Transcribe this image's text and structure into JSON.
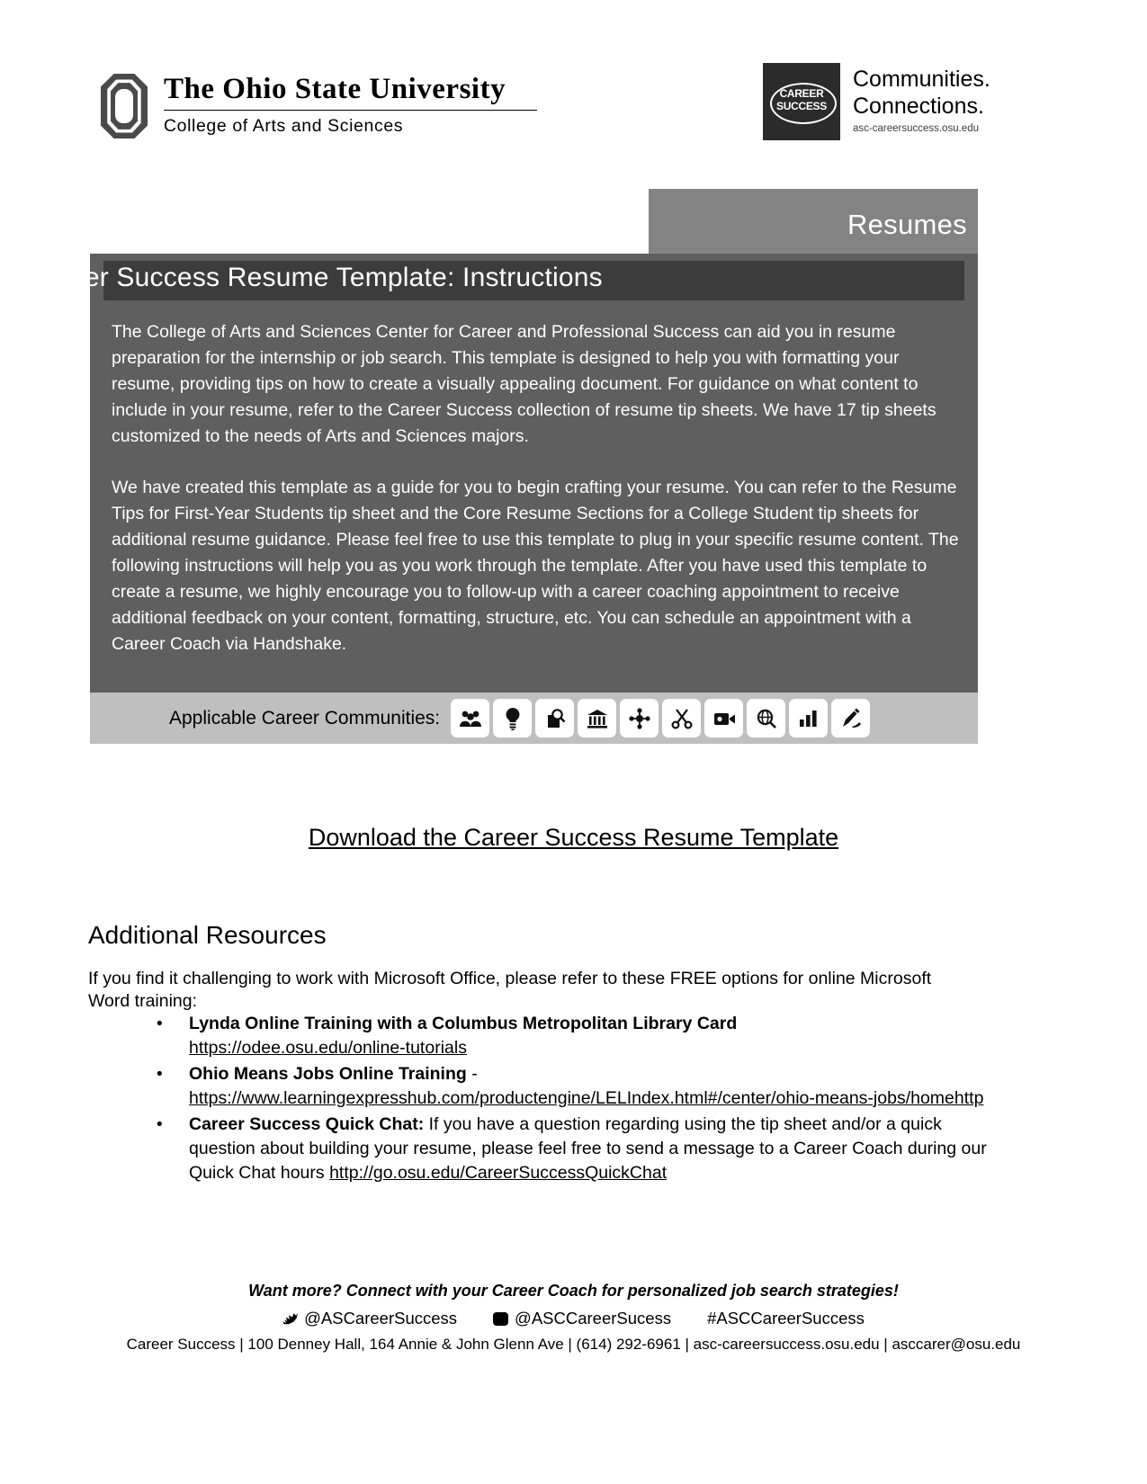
{
  "header": {
    "osu_title": "The Ohio State University",
    "osu_subtitle": "College of Arts and Sciences",
    "cs_badge_line1": "CAREER",
    "cs_badge_line2": "SUCCESS",
    "cs_line1": "Communities.",
    "cs_line2": "Connections.",
    "cs_url": "asc-careersuccess.osu.edu"
  },
  "tab": {
    "label": "Resumes"
  },
  "panel": {
    "title": "Career Success Resume Template: Instructions",
    "paragraph1": "The College of Arts and Sciences Center for Career and Professional Success can aid you in resume preparation for the internship or job search. This template is designed to help you with formatting your resume, providing tips on how to create a visually appealing document. For guidance on what content to include in your resume, refer to the Career Success collection of resume tip sheets.  We have 17 tip sheets customized to the needs of Arts and Sciences majors.",
    "paragraph2": "We have created this template as a guide for you to begin crafting your resume. You can refer to the Resume Tips for First-Year Students tip sheet and the Core Resume Sections for a College Student tip sheets for additional resume guidance. Please feel free to use this template to plug in your specific resume content. The following instructions will help you as you work through the template. After you have used this template to create a resume, we highly encourage you to follow-up with a career coaching appointment to receive additional feedback on your content, formatting, structure, etc. You can schedule an appointment with a Career Coach via Handshake."
  },
  "career_communities": {
    "label": "Applicable Career Communities:",
    "icons": [
      {
        "name": "people-group-icon",
        "glyph": "⚘"
      },
      {
        "name": "lightbulb-idea-icon",
        "glyph": "Ὂ1"
      },
      {
        "name": "magnifier-document-icon",
        "glyph": "⚲"
      },
      {
        "name": "government-building-icon",
        "glyph": "ἽB"
      },
      {
        "name": "network-nodes-icon",
        "glyph": "✤"
      },
      {
        "name": "scissors-arts-icon",
        "glyph": "✂"
      },
      {
        "name": "film-camera-icon",
        "glyph": "Ἲ5"
      },
      {
        "name": "globe-search-icon",
        "glyph": "ὐD"
      },
      {
        "name": "chart-growth-icon",
        "glyph": "Ὄ8"
      },
      {
        "name": "paint-tools-icon",
        "glyph": "✎"
      }
    ]
  },
  "download": {
    "label": "Download the Career Success Resume Template"
  },
  "resources": {
    "heading": "Additional Resources",
    "intro": "If you find it challenging to work with Microsoft Office, please refer to these FREE options for online Microsoft Word training:",
    "bullet_char": "•",
    "items": [
      {
        "title": "Lynda Online Training with a Columbus Metropolitan Library Card",
        "title_suffix": "",
        "link": "https://odee.osu.edu/online-tutorials",
        "body": ""
      },
      {
        "title": "Ohio Means Jobs Online Training",
        "title_suffix": " -",
        "link": "https://www.learningexpresshub.com/productengine/LELIndex.html#/center/ohio-means-jobs/homehttp",
        "body": ""
      },
      {
        "title": "Career Success Quick Chat:",
        "title_suffix": "",
        "body": " If you have a question regarding using the tip sheet and/or a quick question about building your resume, please feel free to send a message to a Career Coach during our Quick Chat hours ",
        "link": "http://go.osu.edu/CareerSuccessQuickChat"
      }
    ]
  },
  "footer": {
    "tagline": "Want more? Connect with your Career Coach for personalized job search strategies!",
    "twitter_handle": "@ASCareerSuccess",
    "instagram_handle": "@ASCCareerSucess",
    "hashtag": "#ASCCareerSuccess",
    "address": "Career Success | 100 Denney Hall, 164 Annie & John Glenn Ave | (614) 292-6961 | asc-careersuccess.osu.edu | asccarer@osu.edu"
  }
}
